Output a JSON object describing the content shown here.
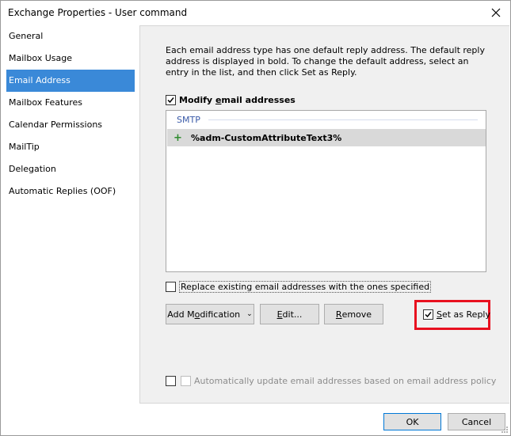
{
  "window": {
    "title": "Exchange Properties - User command"
  },
  "sidebar": {
    "items": [
      {
        "label": "General"
      },
      {
        "label": "Mailbox Usage"
      },
      {
        "label": "Email Address"
      },
      {
        "label": "Mailbox Features"
      },
      {
        "label": "Calendar Permissions"
      },
      {
        "label": "MailTip"
      },
      {
        "label": "Delegation"
      },
      {
        "label": "Automatic Replies (OOF)"
      }
    ],
    "selected": "Email Address"
  },
  "main": {
    "description": "Each email address type has one default reply address. The default reply address is displayed in bold. To change the default address, select an entry in the list, and then click Set as Reply.",
    "modify_checkbox": {
      "label_pre": "Modify ",
      "label_u": "e",
      "label_post": "mail addresses",
      "checked": true
    },
    "list": {
      "group": "SMTP",
      "rows": [
        {
          "prefix": "+",
          "address": "%adm-CustomAttributeText3%"
        }
      ]
    },
    "replace_checkbox": {
      "label": "Replace existing email addresses with the ones specified",
      "checked": false
    },
    "buttons": {
      "add_modification_pre": "Add M",
      "add_modification_u": "o",
      "add_modification_post": "dification",
      "edit_u": "E",
      "edit_post": "dit...",
      "remove_u": "R",
      "remove_post": "emove"
    },
    "set_as_reply": {
      "label_u": "S",
      "label_post": "et as Reply",
      "checked": true
    },
    "auto_update": {
      "label": "Automatically update email addresses based on email address policy",
      "checked": false
    }
  },
  "footer": {
    "ok": "OK",
    "cancel": "Cancel"
  },
  "colors": {
    "selection": "#3a89d8",
    "highlight": "#e8101f",
    "plus": "#2e8b2e"
  }
}
